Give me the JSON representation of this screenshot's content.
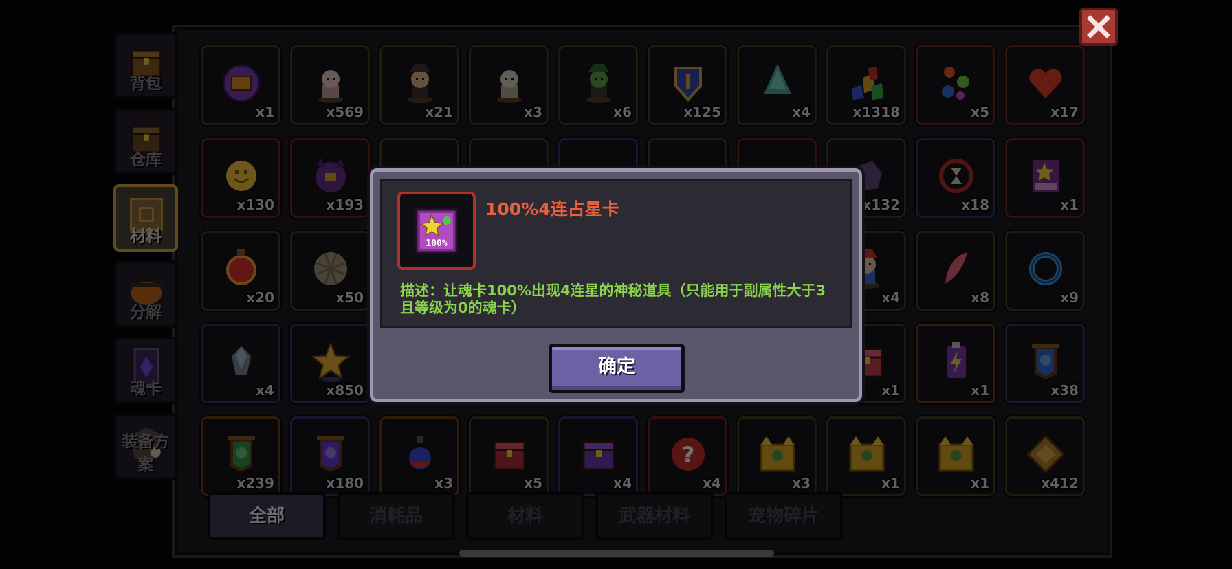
{
  "side_tabs": [
    {
      "id": "backpack",
      "label": "背包",
      "icon": "chest-icon",
      "active": false
    },
    {
      "id": "warehouse",
      "label": "仓库",
      "icon": "warehouse-chest-icon",
      "active": false
    },
    {
      "id": "materials",
      "label": "材料",
      "icon": "materials-box-icon",
      "active": true
    },
    {
      "id": "decompose",
      "label": "分解",
      "icon": "pumpkin-cauldron-icon",
      "active": false
    },
    {
      "id": "soul-card",
      "label": "魂卡",
      "icon": "soul-card-icon",
      "active": false
    },
    {
      "id": "equip-plan",
      "label": "装备方案",
      "icon": "armor-plan-icon",
      "active": false
    }
  ],
  "grid_items": [
    {
      "icon": "purple-chest-token-icon",
      "count": "x1",
      "rarity": "gold"
    },
    {
      "icon": "pig-figurine-icon",
      "count": "x569",
      "rarity": "gold"
    },
    {
      "icon": "wizard-figurine-icon",
      "count": "x21",
      "rarity": "gold"
    },
    {
      "icon": "knight-figurine-icon",
      "count": "x3",
      "rarity": "gold"
    },
    {
      "icon": "goblin-figurine-icon",
      "count": "x6",
      "rarity": "gold"
    },
    {
      "icon": "blue-shield-badge-icon",
      "count": "x125",
      "rarity": "gold"
    },
    {
      "icon": "teal-crystal-tree-icon",
      "count": "x4",
      "rarity": "gold"
    },
    {
      "icon": "gem-cluster-icon",
      "count": "x1318",
      "rarity": "gold"
    },
    {
      "icon": "colored-orbs-icon",
      "count": "x5",
      "rarity": "red"
    },
    {
      "icon": "red-heart-icon",
      "count": "x17",
      "rarity": "red"
    },
    {
      "icon": "yellow-smiley-icon",
      "count": "x130",
      "rarity": "red"
    },
    {
      "icon": "purple-horned-mask-icon",
      "count": "x193",
      "rarity": "red"
    },
    {
      "icon": "hidden-item-icon",
      "count": "",
      "rarity": "gold"
    },
    {
      "icon": "hidden-item-icon",
      "count": "",
      "rarity": "gold"
    },
    {
      "icon": "hidden-item-icon",
      "count": "",
      "rarity": "purple"
    },
    {
      "icon": "hidden-item-icon",
      "count": "",
      "rarity": "gold"
    },
    {
      "icon": "hidden-item-icon",
      "count": "",
      "rarity": "red"
    },
    {
      "icon": "purple-rock-icon",
      "count": "x132",
      "rarity": "gold"
    },
    {
      "icon": "red-ring-hourglass-icon",
      "count": "x18",
      "rarity": "purple"
    },
    {
      "icon": "star-card-100-icon",
      "count": "x1",
      "rarity": "red"
    },
    {
      "icon": "number-three-medal-icon",
      "count": "x20",
      "rarity": "gold"
    },
    {
      "icon": "woven-ball-icon",
      "count": "x50",
      "rarity": "gold"
    },
    {
      "icon": "hidden-item-icon",
      "count": "",
      "rarity": "gold"
    },
    {
      "icon": "hidden-item-icon",
      "count": "",
      "rarity": "gold"
    },
    {
      "icon": "hidden-item-icon",
      "count": "",
      "rarity": "gold"
    },
    {
      "icon": "hidden-item-icon",
      "count": "",
      "rarity": "gold"
    },
    {
      "icon": "hidden-item-icon",
      "count": "",
      "rarity": "gold"
    },
    {
      "icon": "colorful-figurine-icon",
      "count": "x4",
      "rarity": "gold"
    },
    {
      "icon": "pink-feather-icon",
      "count": "x8",
      "rarity": "gold"
    },
    {
      "icon": "blue-ring-icon",
      "count": "x9",
      "rarity": "gold"
    },
    {
      "icon": "gray-crystal-icon",
      "count": "x4",
      "rarity": "purple"
    },
    {
      "icon": "gold-star-icon",
      "count": "x850",
      "rarity": "purple"
    },
    {
      "icon": "hidden-item-icon",
      "count": "",
      "rarity": "gold"
    },
    {
      "icon": "hidden-item-icon",
      "count": "",
      "rarity": "gold"
    },
    {
      "icon": "hidden-item-icon",
      "count": "",
      "rarity": "gold"
    },
    {
      "icon": "hidden-item-icon",
      "count": "",
      "rarity": "gold"
    },
    {
      "icon": "hidden-item-icon",
      "count": "",
      "rarity": "gold"
    },
    {
      "icon": "pink-chest-icon",
      "count": "x1",
      "rarity": "gold"
    },
    {
      "icon": "lightning-battery-icon",
      "count": "x1",
      "rarity": "orange"
    },
    {
      "icon": "blue-heart-banner-icon",
      "count": "x38",
      "rarity": "purple"
    },
    {
      "icon": "green-leaf-banner-icon",
      "count": "x239",
      "rarity": "orange"
    },
    {
      "icon": "purple-crystal-banner-icon",
      "count": "x180",
      "rarity": "purple"
    },
    {
      "icon": "blue-red-potion-icon",
      "count": "x3",
      "rarity": "orange"
    },
    {
      "icon": "red-gift-chest-icon",
      "count": "x5",
      "rarity": "gold"
    },
    {
      "icon": "purple-gift-chest-icon",
      "count": "x4",
      "rarity": "purple"
    },
    {
      "icon": "mystery-question-icon",
      "count": "x4",
      "rarity": "red"
    },
    {
      "icon": "golden-dragon-chest-icon",
      "count": "x3",
      "rarity": "gold"
    },
    {
      "icon": "golden-dragon-chest-icon",
      "count": "x1",
      "rarity": "gold"
    },
    {
      "icon": "golden-dragon-chest-icon",
      "count": "x1",
      "rarity": "gold"
    },
    {
      "icon": "gold-diamond-tile-icon",
      "count": "x412",
      "rarity": "gold"
    }
  ],
  "bottom_tabs": [
    {
      "label": "全部",
      "active": true
    },
    {
      "label": "消耗品",
      "active": false
    },
    {
      "label": "材料",
      "active": false
    },
    {
      "label": "武器材料",
      "active": false
    },
    {
      "label": "宠物碎片",
      "active": false
    }
  ],
  "dialog": {
    "title": "100%4连占星卡",
    "description": "描述：让魂卡100%出现4连星的神秘道具（只能用于副属性大于3且等级为0的魂卡）",
    "icon": "star-card-100-icon",
    "icon_text": "100%",
    "confirm_label": "确定"
  },
  "close_icon": "close-icon",
  "colors": {
    "title": "#e8603e",
    "description": "#8ad34c",
    "confirm_button": "#6b62a6",
    "close_button": "#a93a33",
    "selected_tab_border": "#d5a24a"
  }
}
